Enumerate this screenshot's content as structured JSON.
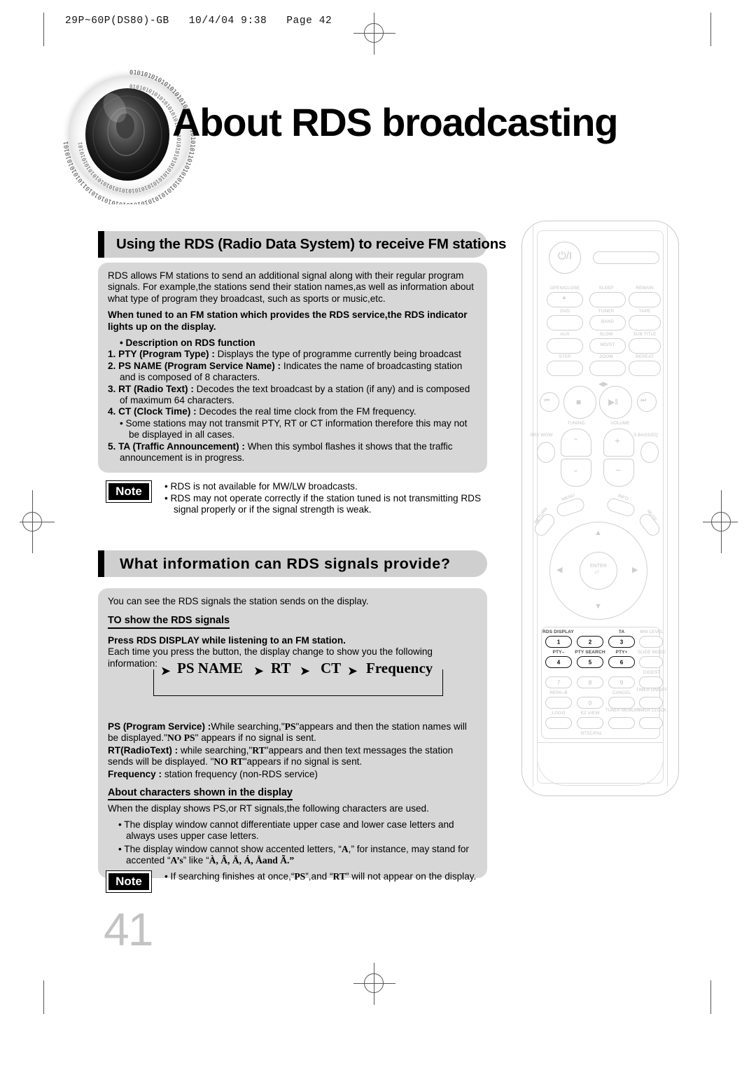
{
  "file_header": "29P~60P(DS80)-GB   10/4/04 9:38   Page 42",
  "page_title": "About RDS broadcasting",
  "page_number": "41",
  "sections": [
    {
      "heading": "Using the RDS (Radio Data System) to receive FM stations",
      "intro": "RDS allows FM stations to send an additional signal along with their regular program signals. For example,the stations send their station names,as well as information about what  type of program they broadcast, such as sports or music,etc.",
      "bold_note": "When tuned to an FM station which provides the RDS service,the RDS indicator lights up on the display.",
      "list_title": "• Description on RDS function",
      "items": [
        {
          "num": "1.",
          "term": "PTY (Program Type) :",
          "desc": " Displays the type of programme currently being broadcast"
        },
        {
          "num": "2.",
          "term": "PS NAME (Program Service Name) :",
          "desc": " Indicates the name of broadcasting station and is composed of 8 characters."
        },
        {
          "num": "3.",
          "term": "RT (Radio Text) :",
          "desc": " Decodes the text broadcast by a station (if any) and is composed of maximum 64 characters."
        },
        {
          "num": "4.",
          "term": "CT (Clock Time) :",
          "desc": " Decodes the real time clock from the FM frequency."
        },
        {
          "num": "5.",
          "term": "TA (Traffic Announcement) :",
          "desc": " When this symbol flashes it shows that the traffic announcement is in progress."
        }
      ],
      "sub_bullet": "• Some stations may not transmit PTY, RT or CT information therefore this may not be displayed in all cases."
    }
  ],
  "note1": {
    "label": "Note",
    "bullets": [
      "• RDS is not available for MW/LW broadcasts.",
      "• RDS may not operate correctly if the station tuned is not transmitting RDS signal properly or if the signal strength is weak."
    ]
  },
  "section2": {
    "heading": "What information can RDS signals provide?",
    "intro": "You can see the RDS signals the station sends on the display.",
    "sub1": "TO show the RDS signals",
    "bold_line": "Press RDS DISPLAY while listening to an FM station.",
    "line2": "Each time you press the button, the display change to show you the following information:",
    "flow": {
      "steps": [
        "PS NAME",
        "RT",
        "CT",
        "Frequency"
      ],
      "arrow": "➤"
    },
    "defs": [
      {
        "term": "PS (Program Service) :",
        "text_a": "While searching,\"",
        "q1": "PS",
        "text_b": "\"appears and then the station names will be displayed.\"",
        "q2": "NO PS",
        "text_c": "\" appears if no signal is sent."
      },
      {
        "term": "RT(RadioText) :",
        "text_a": " while searching,\"",
        "q1": "RT",
        "text_b": "\"appears and then text messages the station sends will be displayed. \"",
        "q2": "NO RT",
        "text_c": "\"appears if no signal is sent."
      },
      {
        "term": "Frequency :",
        "text_a": " station frequency (non-RDS service)",
        "q1": "",
        "text_b": "",
        "q2": "",
        "text_c": ""
      }
    ],
    "sub2": "About characters shown in the display",
    "sub2_line": "When the display shows PS,or RT signals,the following characters are used.",
    "bullets": [
      "• The display window cannot differentiate upper case and lower case letters and always uses upper case letters."
    ],
    "accent_bullet_a": "• The display window  cannot show accented letters, “",
    "accent_A": "A",
    "accent_bullet_b": ",” for instance, may stand for accented “",
    "accent_As": "A’s",
    "accent_bullet_c": "” like “",
    "accent_list": "À, Â, Ä, Á, Åand Ã.”"
  },
  "note2": {
    "label": "Note",
    "bullet_a": "• If searching finishes at once,“",
    "q1": "PS",
    "bullet_b": "”,and “",
    "q2": "RT",
    "bullet_c": "” will not appear on the display."
  },
  "remote": {
    "name": "remote-control-illustration",
    "power_glyph": "⏻/I",
    "rows": [
      {
        "labels": [
          "OPEN/CLOSE",
          "SLEEP",
          "REMAIN"
        ]
      },
      {
        "labels": [
          "DVD",
          "TUNER",
          "TAPE"
        ],
        "sub": [
          "",
          "BAND",
          ""
        ]
      },
      {
        "labels": [
          "AUX",
          "SLOW",
          "SUB TITLE"
        ],
        "sub": [
          "",
          "MO/ST",
          ""
        ]
      },
      {
        "labels": [
          "STEP",
          "ZOOM",
          "REPEAT"
        ]
      }
    ],
    "transport": [
      "⏮",
      "■",
      "▶‖",
      "⏭"
    ],
    "tuning_label": "TUNING",
    "volume_label": "VOLUME",
    "srs_label": "SRS WOW",
    "bass_label": "S.BASS/EQ",
    "nav": {
      "menu": "MENU",
      "info": "INFO",
      "return": "RETURN",
      "mute": "MUTE",
      "enter": "ENTER"
    },
    "keypad": [
      {
        "label": "RDS DISPLAY",
        "num": "1",
        "highlight": true
      },
      {
        "label": "",
        "num": "2",
        "highlight": true
      },
      {
        "label": "TA",
        "num": "3",
        "highlight": true
      },
      {
        "label": "MW LEVEL",
        "num": "",
        "highlight": false
      },
      {
        "label": "PTY–",
        "num": "4",
        "highlight": true
      },
      {
        "label": "PTY SEARCH",
        "num": "5",
        "highlight": true
      },
      {
        "label": "PTY+",
        "num": "6",
        "highlight": true
      },
      {
        "label": "SLIDE MODE",
        "num": "",
        "highlight": false
      },
      {
        "label": "",
        "num": "7",
        "highlight": false
      },
      {
        "label": "",
        "num": "8",
        "highlight": false
      },
      {
        "label": "",
        "num": "9",
        "highlight": false
      },
      {
        "label": "DIGEST",
        "num": "",
        "highlight": false
      },
      {
        "label": "REPA–B",
        "num": "",
        "highlight": false
      },
      {
        "label": "",
        "num": "0",
        "highlight": false
      },
      {
        "label": "CANCEL",
        "num": "",
        "highlight": false
      },
      {
        "label": "TIMER ON/OFF",
        "num": "",
        "highlight": false
      },
      {
        "label": "LOGO",
        "num": "",
        "highlight": false
      },
      {
        "label": "EZ VIEW",
        "num": "",
        "highlight": false
      },
      {
        "label": "TUNER MEMORY",
        "num": "",
        "highlight": false
      },
      {
        "label": "TIMER CLOCK",
        "num": "",
        "highlight": false
      }
    ],
    "ntsc": "NTSC/PAL"
  },
  "colors": {
    "panel_bg": "#d7d7d7",
    "heading_bg": "#cfcfcf",
    "page_number": "#c3c3c3",
    "remote_outline": "#cfcfcf"
  }
}
